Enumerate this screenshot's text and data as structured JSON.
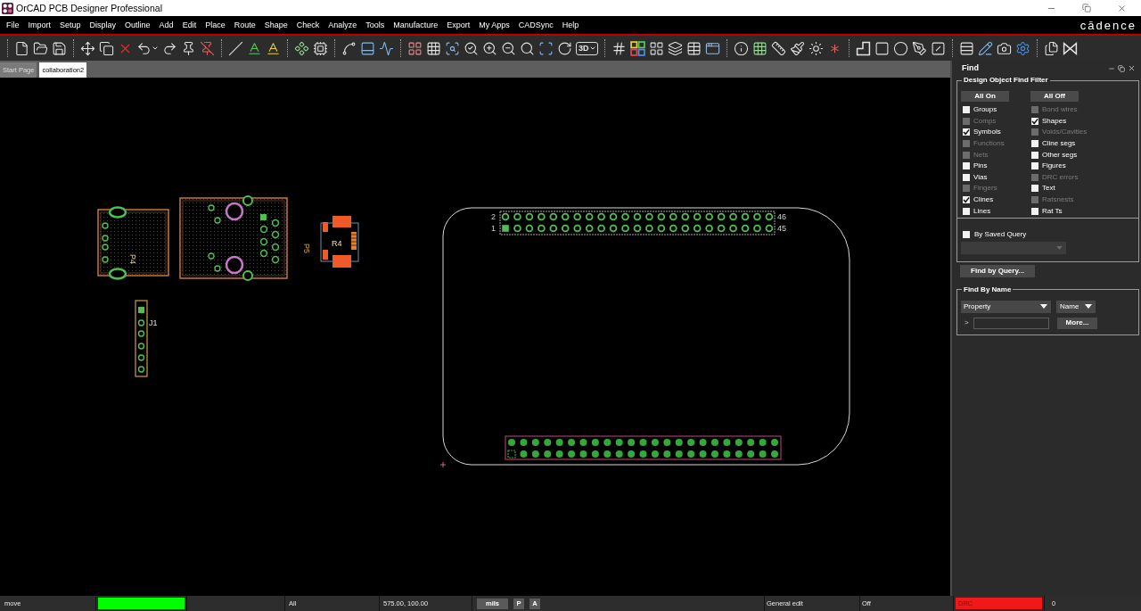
{
  "window": {
    "title": "OrCAD PCB Designer Professional",
    "brand": "cādence"
  },
  "menu": [
    "File",
    "Import",
    "Setup",
    "Display",
    "Outline",
    "Add",
    "Edit",
    "Place",
    "Route",
    "Shape",
    "Check",
    "Analyze",
    "Tools",
    "Manufacture",
    "Export",
    "My Apps",
    "CADSync",
    "Help"
  ],
  "toolbar": {
    "view_3d": "3D"
  },
  "tabs": [
    {
      "label": "Start Page",
      "selected": false
    },
    {
      "label": "collaboration2",
      "selected": true
    }
  ],
  "canvas": {
    "components": [
      {
        "kind": "oval_connector",
        "label": "P4"
      },
      {
        "kind": "jack"
      },
      {
        "kind": "smd_part",
        "label": "P5",
        "inner_label": "R4"
      },
      {
        "kind": "single_row_header",
        "label": "J1"
      }
    ],
    "board": {
      "headers": [
        {
          "kind": "ring_pads",
          "pin_labels": [
            "2",
            "1",
            "46",
            "45"
          ]
        },
        {
          "kind": "filled_pads"
        }
      ]
    }
  },
  "find_panel": {
    "title": "Find",
    "filter": {
      "title": "Design Object Find Filter",
      "buttons": [
        "All On",
        "All Off"
      ],
      "options": [
        {
          "label": "Groups",
          "checked": false,
          "disabled": false
        },
        {
          "label": "Comps",
          "checked": false,
          "disabled": true
        },
        {
          "label": "Symbols",
          "checked": true,
          "disabled": false
        },
        {
          "label": "Functions",
          "checked": false,
          "disabled": true
        },
        {
          "label": "Nets",
          "checked": false,
          "disabled": true
        },
        {
          "label": "Pins",
          "checked": false,
          "disabled": false
        },
        {
          "label": "Vias",
          "checked": false,
          "disabled": false
        },
        {
          "label": "Fingers",
          "checked": false,
          "disabled": true
        },
        {
          "label": "Clines",
          "checked": true,
          "disabled": false
        },
        {
          "label": "Lines",
          "checked": false,
          "disabled": false
        },
        {
          "label": "Bond wires",
          "checked": false,
          "disabled": true
        },
        {
          "label": "Shapes",
          "checked": true,
          "disabled": false
        },
        {
          "label": "Voids/Cavities",
          "checked": false,
          "disabled": true
        },
        {
          "label": "Cline segs",
          "checked": false,
          "disabled": false
        },
        {
          "label": "Other segs",
          "checked": false,
          "disabled": false
        },
        {
          "label": "Figures",
          "checked": false,
          "disabled": false
        },
        {
          "label": "DRC errors",
          "checked": false,
          "disabled": true
        },
        {
          "label": "Text",
          "checked": false,
          "disabled": false
        },
        {
          "label": "Ratsnests",
          "checked": false,
          "disabled": true
        },
        {
          "label": "Rat Ts",
          "checked": false,
          "disabled": false
        }
      ]
    },
    "saved_query": {
      "label": "By Saved Query",
      "checked": false,
      "dropdown_disabled": true
    },
    "query_button": "Find by Query...",
    "find_by_name": {
      "title": "Find By Name",
      "object_type": "Property",
      "match_by": "Name",
      "prompt": ">",
      "more_button": "More..."
    }
  },
  "status_bar": {
    "command": "move",
    "busy": false,
    "subclass": "All",
    "coordinates": "575.00, 100.00",
    "units": "mils",
    "toggles": [
      "P",
      "A"
    ],
    "mode": "General edit",
    "drc_mode": "Off",
    "drc": {
      "label": "DRC",
      "out_of_date": true
    },
    "drc_count": "0"
  }
}
